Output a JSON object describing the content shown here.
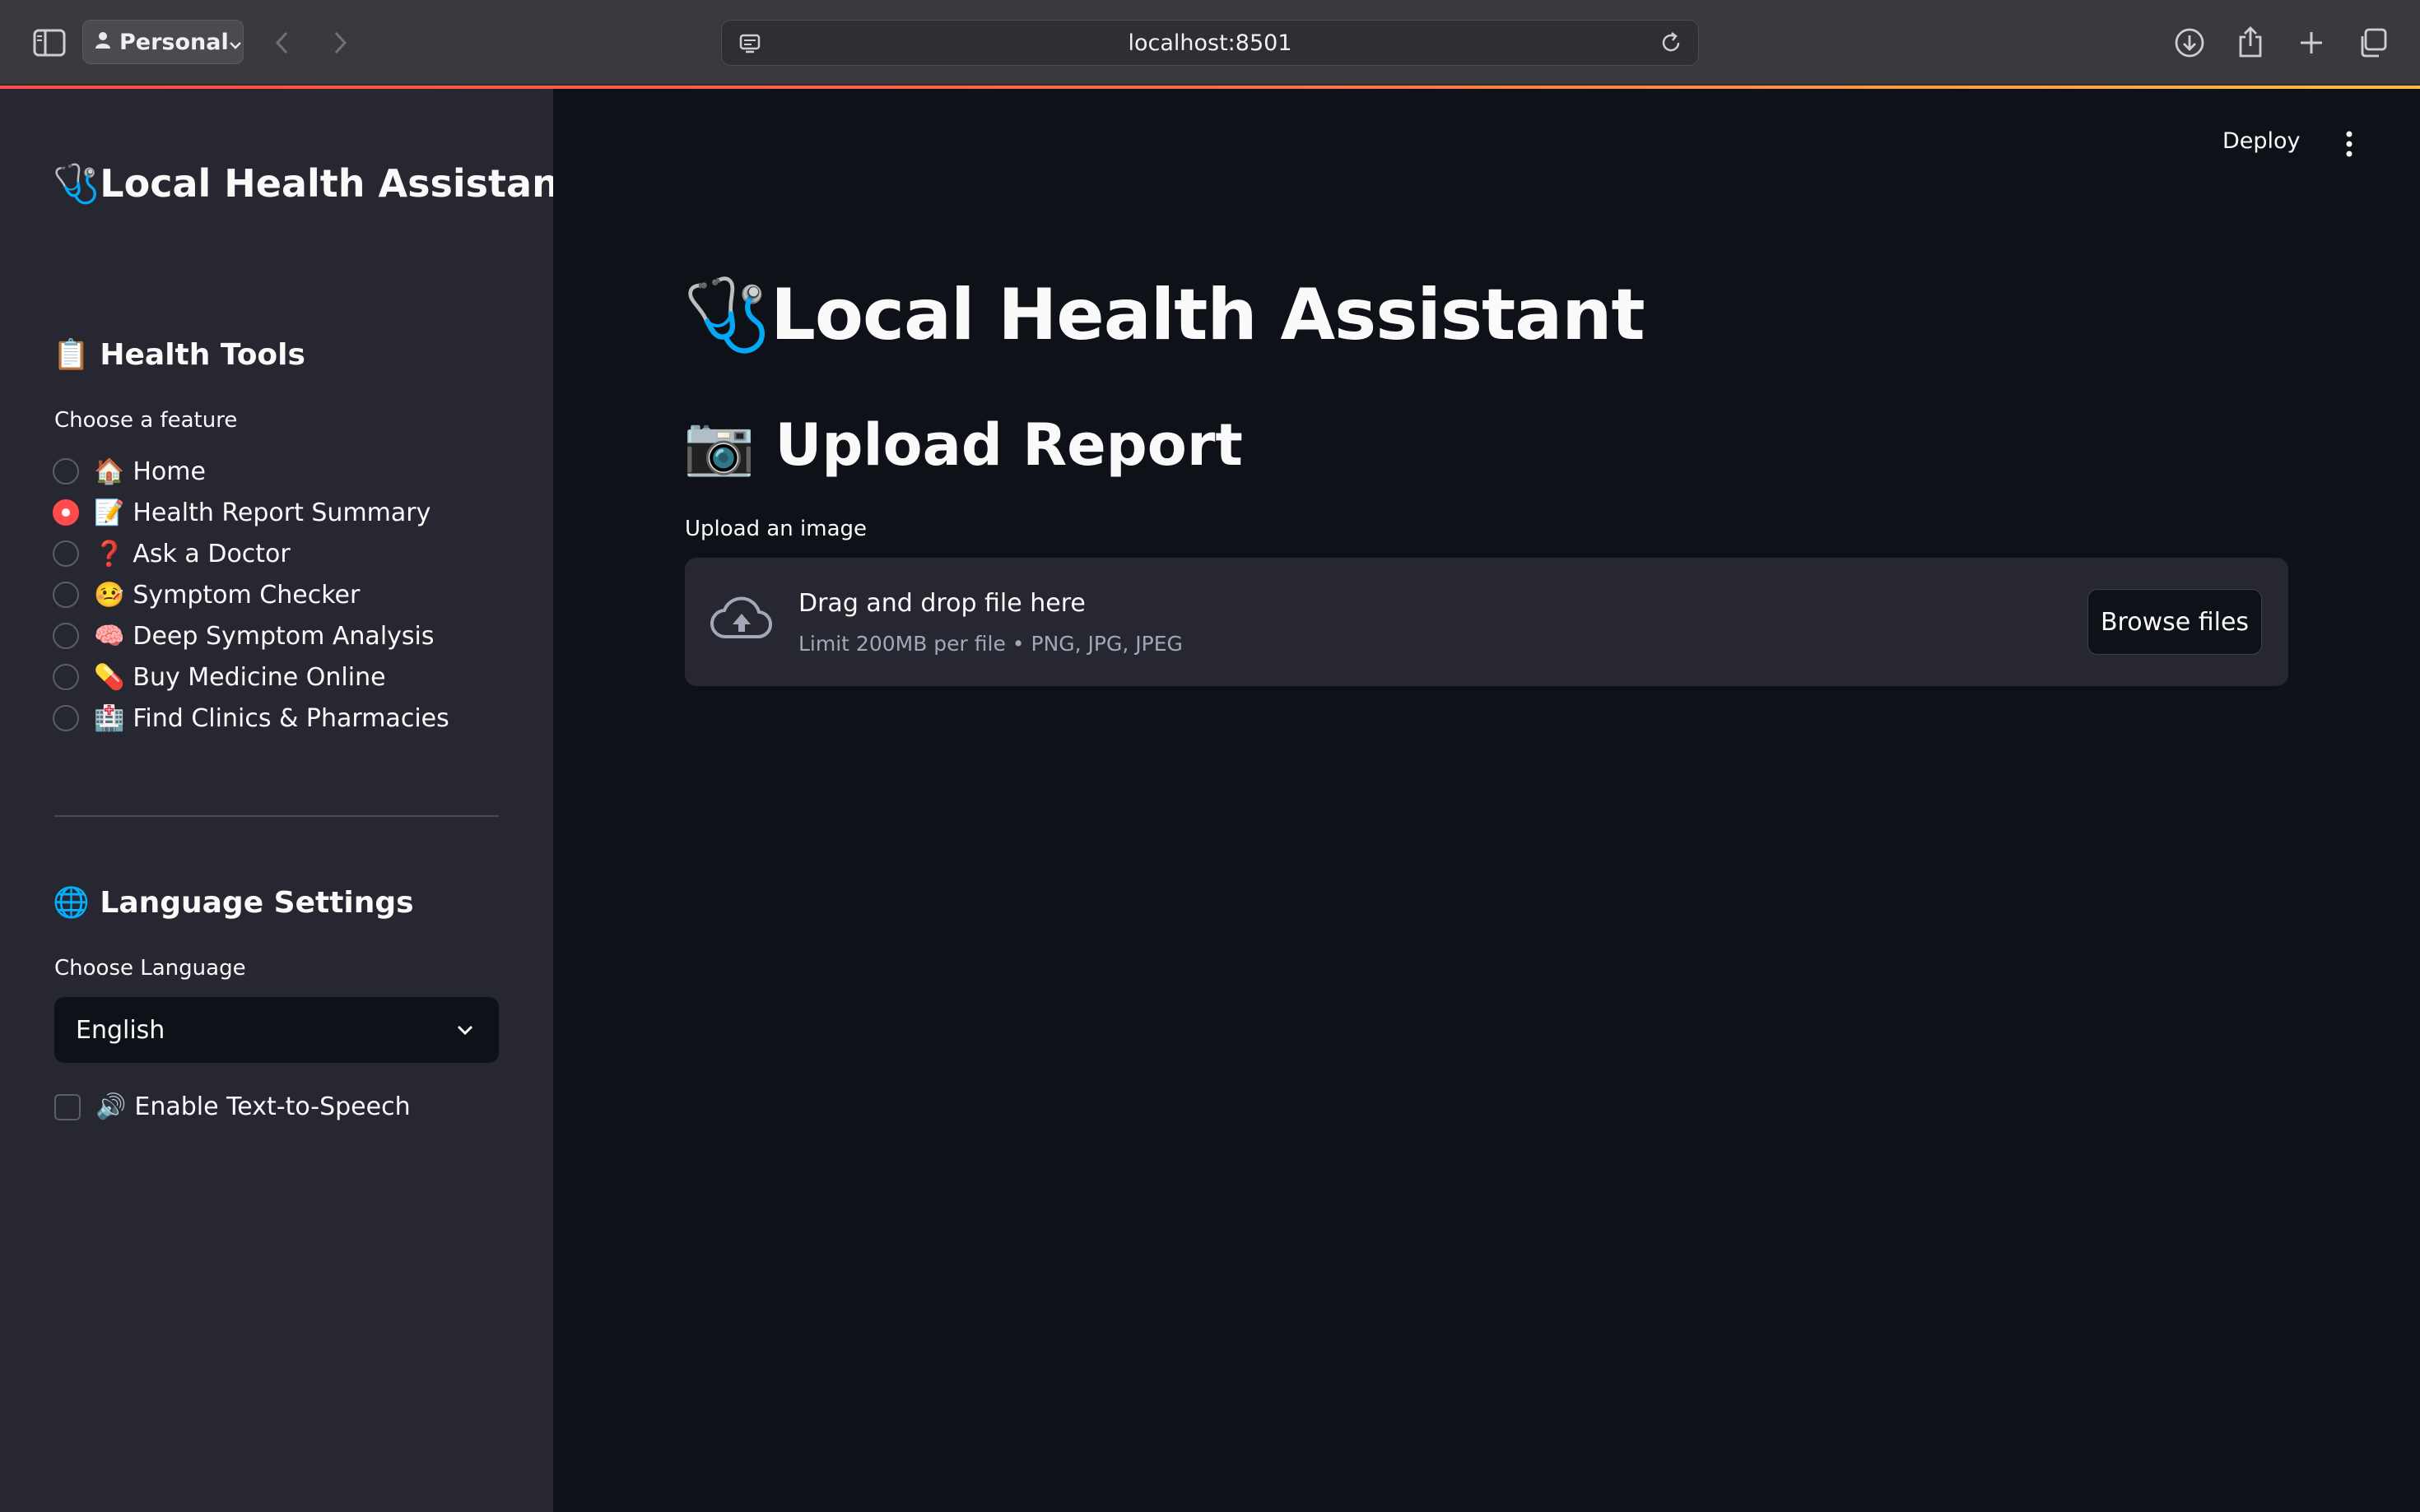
{
  "browser": {
    "profile_label": "Personal",
    "url": "localhost:8501"
  },
  "sidebar": {
    "app_title_icon": "🩺",
    "app_title": "Local Health Assistant",
    "tools_heading_icon": "📋",
    "tools_heading": "Health Tools",
    "feature_label": "Choose a feature",
    "features": [
      {
        "emoji": "🏠",
        "label": "Home",
        "selected": false
      },
      {
        "emoji": "📝",
        "label": "Health Report Summary",
        "selected": true
      },
      {
        "emoji": "❓",
        "label": "Ask a Doctor",
        "selected": false
      },
      {
        "emoji": "🤒",
        "label": "Symptom Checker",
        "selected": false
      },
      {
        "emoji": "🧠",
        "label": "Deep Symptom Analysis",
        "selected": false
      },
      {
        "emoji": "💊",
        "label": "Buy Medicine Online",
        "selected": false
      },
      {
        "emoji": "🏥",
        "label": "Find Clinics & Pharmacies",
        "selected": false
      }
    ],
    "language_heading_icon": "🌐",
    "language_heading": "Language Settings",
    "language_label": "Choose Language",
    "language_value": "English",
    "tts_icon": "🔊",
    "tts_label": "Enable Text-to-Speech"
  },
  "header": {
    "deploy_label": "Deploy"
  },
  "main": {
    "title_icon": "🩺",
    "title": "Local Health Assistant",
    "section_icon": "📷",
    "section_title": "Upload Report",
    "upload_label": "Upload an image",
    "dropzone_text": "Drag and drop file here",
    "dropzone_limits": "Limit 200MB per file • PNG, JPG, JPEG",
    "browse_label": "Browse files"
  },
  "colors": {
    "primary": "#ff4b4b",
    "sidebar_bg": "#262730",
    "main_bg": "#0e1117"
  }
}
